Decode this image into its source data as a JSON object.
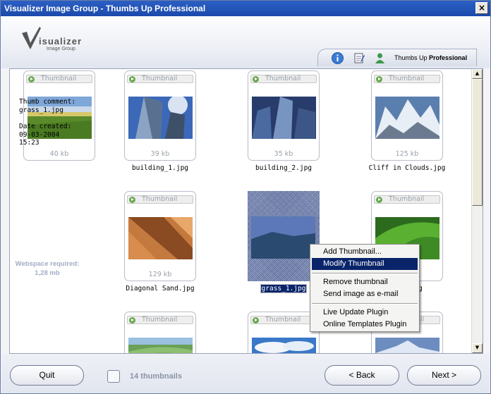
{
  "window": {
    "title": "Visualizer Image Group - Thumbs Up Professional",
    "close_label": "×"
  },
  "logo": {
    "name": "isualizer",
    "sub": "Image Group"
  },
  "tabbar": {
    "product_name": "Thumbs Up",
    "product_edition": "Professional"
  },
  "thumb_label": "Thumbnail",
  "selected_info": {
    "comment_label": "Thumb comment:",
    "comment_value": "grass_1.jpg",
    "date_label": "Date created:",
    "date_value": "09-03-2004",
    "time_value": "15:23"
  },
  "webspace": {
    "label": "Webspace required:",
    "value": "1,28 mb"
  },
  "thumbnails": [
    {
      "name": "grass_1.jpg",
      "size": "40 kb"
    },
    {
      "name": "building_1.jpg",
      "size": "39 kb"
    },
    {
      "name": "building_2.jpg",
      "size": "35 kb"
    },
    {
      "name": "Cliff in Clouds.jpg",
      "size": "125 kb"
    },
    {
      "name": "Diagonal Sand.jpg",
      "size": "129 kb"
    },
    {
      "name": "grass_1.jpg",
      "size": ""
    },
    {
      "name": "pg",
      "size": ""
    }
  ],
  "context_menu": {
    "items": [
      "Add Thumbnail...",
      "Modify Thumbnail",
      "Remove thumbnail",
      "Send image as e-mail",
      "Live Update Plugin",
      "Online Templates Plugin"
    ]
  },
  "footer": {
    "quit": "Quit",
    "count": "14 thumbnails",
    "back": "< Back",
    "next": "Next >"
  },
  "scroll": {
    "up": "▲",
    "down": "▼"
  },
  "colors": {
    "titlebar": "#1b4aab",
    "highlight": "#0a246a"
  }
}
